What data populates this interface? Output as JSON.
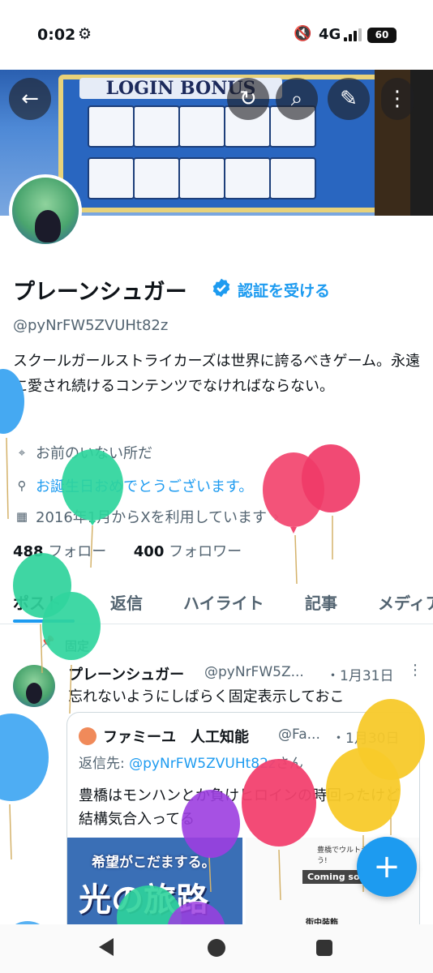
{
  "status_bar": {
    "time": "0:02",
    "network": "4G",
    "battery": "60"
  },
  "banner": {
    "title": "LOGIN BONUS"
  },
  "profile": {
    "name": "プレーンシュガー",
    "verify_label": "認証を受ける",
    "handle": "@pyNrFW5ZVUHt82z",
    "bio": "スクールガールストライカーズは世界に誇るべきゲーム。永遠に愛され続けるコンテンツでなければならない。",
    "location": "お前のいない所だ",
    "website": "お誕生日おめでとうございます。",
    "joined": "2016年1月からXを利用しています",
    "following_count": "488",
    "following_label": "フォロー",
    "followers_count": "400",
    "followers_label": "フォロワー"
  },
  "tabs": [
    {
      "label": "ポスト"
    },
    {
      "label": "返信"
    },
    {
      "label": "ハイライト"
    },
    {
      "label": "記事"
    },
    {
      "label": "メディア"
    }
  ],
  "pinned_post": {
    "pinned_label": "固定",
    "author": "プレーンシュガー",
    "handle": "@pyNrFW5Z...",
    "date": "・1月31日",
    "text": "忘れないようにしばらく固定表示しておこ",
    "quote": {
      "author": "ファミーユ　人工知能",
      "handle": "@Fa...",
      "date": "・1月30日",
      "reply_prefix": "返信先: ",
      "reply_to": "@pyNrFW5ZVUHt82z",
      "reply_suffix": "さん",
      "text": "豊橋はモンハンとか負けヒロインの時回ったけど結構気合入ってる",
      "image1_line1": "希望がこだまする。",
      "image1_line2": "光の旅路",
      "image2_caption": "豊橋でウルトラマンを楽しもう!",
      "image2_badge": "Coming soon",
      "image2_footer": "街中装飾"
    }
  },
  "balloon_colors": [
    "#3fa6f0",
    "#2fd49a",
    "#f2406e",
    "#f7c928",
    "#9b3fe0"
  ]
}
